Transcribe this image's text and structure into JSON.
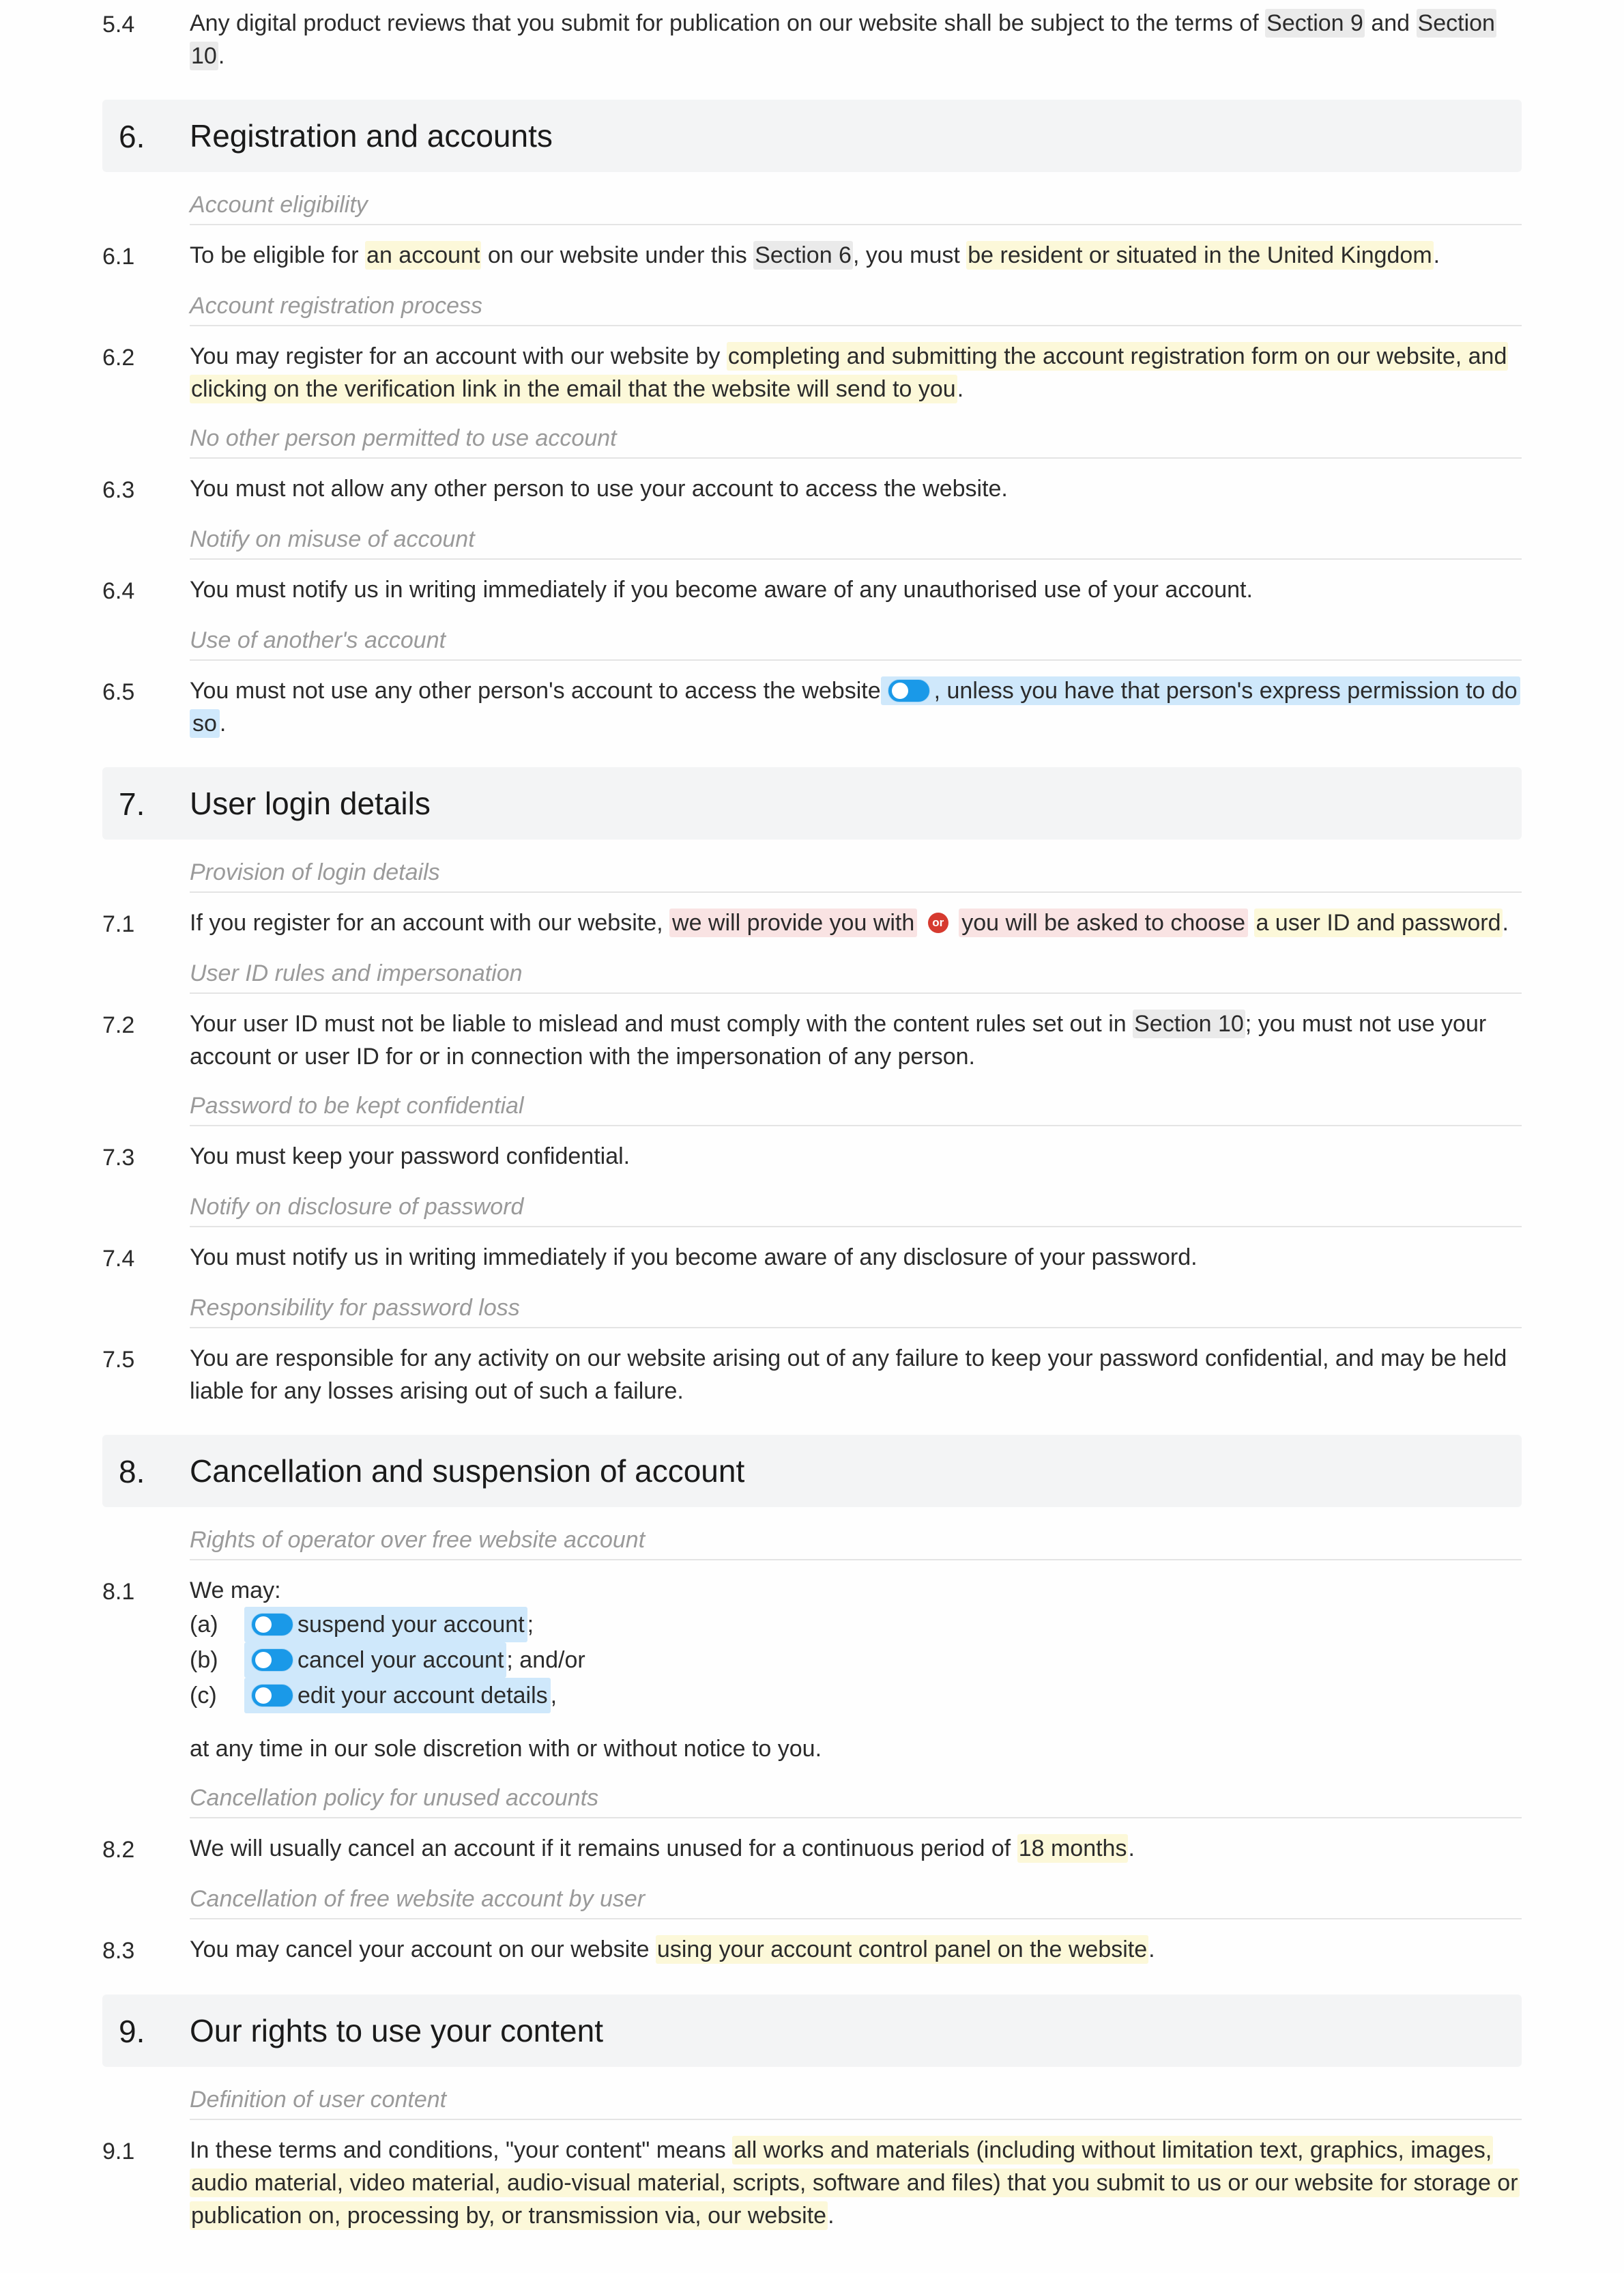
{
  "c54": {
    "num": "5.4",
    "t1": "Any digital product reviews that you submit for publication on our website shall be subject to the terms of ",
    "g1": "Section 9",
    "t2": " and ",
    "g2": "Section 10",
    "t3": "."
  },
  "s6": {
    "num": "6.",
    "title": "Registration and accounts"
  },
  "n61": "Account eligibility",
  "c61": {
    "num": "6.1",
    "t1": "To be eligible for ",
    "h1": "an account",
    "t2": " on our website under this ",
    "g1": "Section 6",
    "t3": ", you must ",
    "h2": "be resident or situated in the United Kingdom",
    "t4": "."
  },
  "n62": "Account registration process",
  "c62": {
    "num": "6.2",
    "t1": "You may register for an account with our website by ",
    "h1": "completing and submitting the account registration form on our website, and clicking on the verification link in the email that the website will send to you",
    "t2": "."
  },
  "n63": "No other person permitted to use account",
  "c63": {
    "num": "6.3",
    "t1": "You must not allow any other person to use your account to access the website."
  },
  "n64": "Notify on misuse of account",
  "c64": {
    "num": "6.4",
    "t1": "You must notify us in writing immediately if you become aware of any unauthorised use of your account."
  },
  "n65": "Use of another's account",
  "c65": {
    "num": "6.5",
    "t1": "You must not use any other person's account to access the website",
    "b1": ", unless you have that person's express permission to do so",
    "t2": "."
  },
  "s7": {
    "num": "7.",
    "title": "User login details"
  },
  "n71": "Provision of login details",
  "c71": {
    "num": "7.1",
    "t1": "If you register for an account with our website, ",
    "r1": "we will provide you with",
    "or": "or",
    "r2": "you will be asked to choose",
    "t2": " ",
    "h1": "a user ID and password",
    "t3": "."
  },
  "n72": "User ID rules and impersonation",
  "c72": {
    "num": "7.2",
    "t1": "Your user ID must not be liable to mislead and must comply with the content rules set out in ",
    "g1": "Section 10",
    "t2": "; you must not use your account or user ID for or in connection with the impersonation of any person."
  },
  "n73": "Password to be kept confidential",
  "c73": {
    "num": "7.3",
    "t1": "You must keep your password confidential."
  },
  "n74": "Notify on disclosure of password",
  "c74": {
    "num": "7.4",
    "t1": "You must notify us in writing immediately if you become aware of any disclosure of your password."
  },
  "n75": "Responsibility for password loss",
  "c75": {
    "num": "7.5",
    "t1": "You are responsible for any activity on our website arising out of any failure to keep your password confidential, and may be held liable for any losses arising out of such a failure."
  },
  "s8": {
    "num": "8.",
    "title": "Cancellation and suspension of account"
  },
  "n81": "Rights of operator over free website account",
  "c81": {
    "num": "8.1",
    "lead": "We may:",
    "a_m": "(a)",
    "a_b": "suspend your account",
    "a_t": ";",
    "b_m": "(b)",
    "b_b": "cancel your account",
    "b_t": "; and/or",
    "c_m": "(c)",
    "c_b": "edit your account details",
    "c_t": ",",
    "tail": "at any time in our sole discretion with or without notice to you."
  },
  "n82": "Cancellation policy for unused accounts",
  "c82": {
    "num": "8.2",
    "t1": "We will usually cancel an account if it remains unused for a continuous period of ",
    "h1": "18 months",
    "t2": "."
  },
  "n83": "Cancellation of free website account by user",
  "c83": {
    "num": "8.3",
    "t1": "You may cancel your account on our website ",
    "h1": "using your account control panel on the website",
    "t2": "."
  },
  "s9": {
    "num": "9.",
    "title": "Our rights to use your content"
  },
  "n91": "Definition of user content",
  "c91": {
    "num": "9.1",
    "t1": "In these terms and conditions, \"your content\" means ",
    "h1": "all works and materials (including without limitation text, graphics, images, audio material, video material, audio-visual material, scripts, software and files) that you submit to us or our website for storage or publication on, processing by, or transmission via, our website",
    "t2": "."
  }
}
